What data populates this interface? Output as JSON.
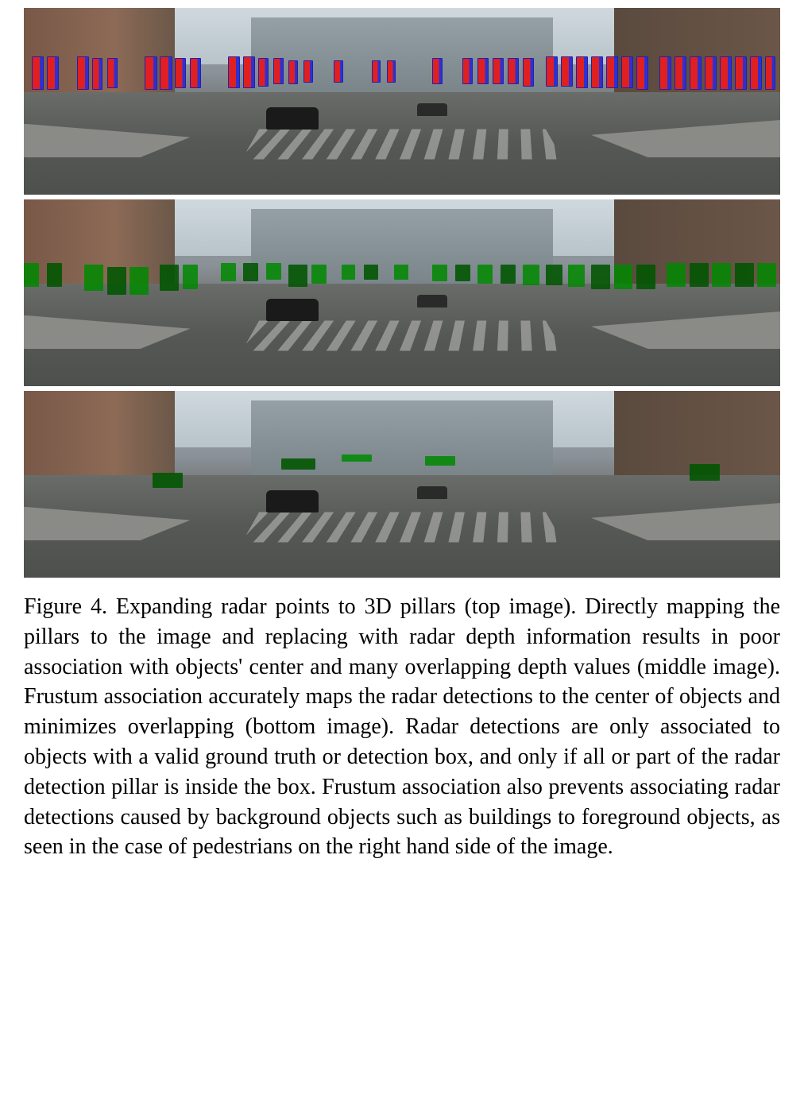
{
  "figure": {
    "label": "Figure 4.",
    "caption_text": "Expanding radar points to 3D pillars (top image). Directly mapping the pillars to the image and replacing with radar depth information results in poor association with objects' center and many overlapping depth values (middle image). Frustum association accurately maps the radar detections to the center of objects and minimizes overlapping (bottom image). Radar detections are only associated to objects with a valid ground truth or detection box, and only if all or part of the radar detection pillar is inside the box. Frustum association also prevents associating radar detections caused by background objects such as buildings to foreground objects, as seen in the case of pedestrians on the right hand side of the image."
  },
  "panels": [
    {
      "id": "top",
      "type": "3d-pillars-red-blue"
    },
    {
      "id": "middle",
      "type": "direct-mapping-green"
    },
    {
      "id": "bottom",
      "type": "frustum-association-green"
    }
  ],
  "chart_data": {
    "type": "image-overlay-comparison",
    "description": "Three stacked street-scene images showing radar detection association methods",
    "scene": "Urban street intersection with crosswalk, buildings, vehicles and pedestrians",
    "panels": [
      {
        "position": "top",
        "method": "3D pillars",
        "overlay_color": "red-blue",
        "detection_count_approx": 40,
        "detection_band_y_percent": [
          25,
          48
        ],
        "characteristic": "Many narrow red/blue vertical pillar outlines spanning across full width at horizon line"
      },
      {
        "position": "middle",
        "method": "Direct mapping",
        "overlay_color": "green",
        "detection_count_approx": 35,
        "detection_band_y_percent": [
          32,
          50
        ],
        "characteristic": "Many overlapping solid green rectangles across full width, poor center alignment"
      },
      {
        "position": "bottom",
        "method": "Frustum association",
        "overlay_color": "green",
        "detection_count_approx": 5,
        "characteristic": "Few non-overlapping green rectangles precisely on vehicle/pedestrian centers",
        "detections_xy_percent": [
          {
            "x": 18,
            "y": 45,
            "w": 4,
            "h": 7
          },
          {
            "x": 35,
            "y": 37,
            "w": 4,
            "h": 5
          },
          {
            "x": 43,
            "y": 35,
            "w": 4,
            "h": 4
          },
          {
            "x": 54,
            "y": 36,
            "w": 4,
            "h": 5
          },
          {
            "x": 89,
            "y": 40,
            "w": 4,
            "h": 8
          }
        ]
      }
    ]
  }
}
